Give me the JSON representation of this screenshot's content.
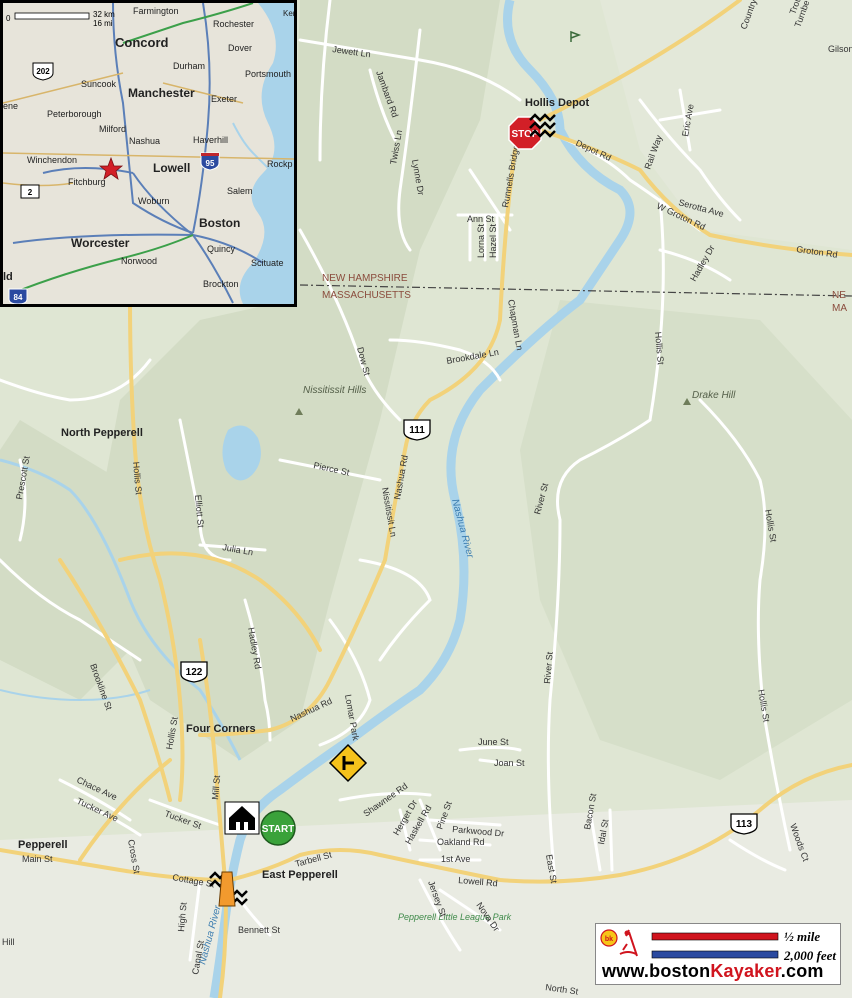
{
  "inset": {
    "scale_km": "32 km",
    "scale_mi": "16 mi",
    "scale_zero": "0",
    "cities": [
      "Farmington",
      "Rochester",
      "Dover",
      "Concord",
      "Durham",
      "Portsmouth",
      "Suncook",
      "Manchester",
      "Exeter",
      "Peterborough",
      "Milford",
      "Nashua",
      "Haverhill",
      "Winchendon",
      "Lowell",
      "Rockp",
      "Fitchburg",
      "Salem",
      "Woburn",
      "Boston",
      "Worcester",
      "Quincy",
      "Norwood",
      "Scituate",
      "Brockton",
      "Ker",
      "ene",
      "ld"
    ],
    "shields": [
      "202",
      "95",
      "2",
      "84"
    ]
  },
  "places": {
    "hollis_depot": "Hollis Depot",
    "north_pepperell": "North Pepperell",
    "four_corners": "Four Corners",
    "pepperell": "Pepperell",
    "east_pepperell": "East Pepperell",
    "nissitissit_hills": "Nissitissit Hills",
    "drake_hill": "Drake Hill",
    "nh": "NEW HAMPSHIRE",
    "ma": "MASSACHUSETTS",
    "ne": "NE",
    "ma2": "MA",
    "little_league": "Pepperell Little League Park",
    "nashua_river": "Nashua River"
  },
  "roads": [
    "Jewett Ln",
    "Jambard Rd",
    "Twiss Ln",
    "Lynne Dr",
    "Runnells Bridge Rd",
    "Ann St",
    "Lorna St",
    "Hazel St",
    "Depot Rd",
    "Rail Way",
    "Eric Ave",
    "Serotta Ave",
    "W Groton Rd",
    "Groton Rd",
    "Hadley Dr",
    "Hollis St",
    "Chapman Ln",
    "Brookdale Ln",
    "Dow St",
    "Pierce St",
    "Nashua Rd",
    "Nissitissit Ln",
    "Elliott St",
    "Julia Ln",
    "Hadley Rd",
    "River St",
    "Prescott St",
    "Brookline St",
    "Lomar Park",
    "June St",
    "Joan St",
    "Chace Ave",
    "Tucker Ave",
    "Tucker St",
    "Mill St",
    "Shawnee Rd",
    "Herget Dr",
    "Haskell Rd",
    "Pine St",
    "Parkwood Dr",
    "Oakland Rd",
    "1st Ave",
    "Tarbell St",
    "Main St",
    "Cross St",
    "Cottage St",
    "Lowell Rd",
    "Bacon St",
    "Idal St",
    "Woods Ct",
    "East St",
    "Jersey St",
    "Nova Dr",
    "Bennett St",
    "High St",
    "Canal St",
    "North St",
    "Gilson",
    "Country Side Dr",
    "Trout Brook",
    "Turnbe",
    "Hill"
  ],
  "shields": {
    "r111": "111",
    "r122": "122",
    "r113": "113"
  },
  "markers": {
    "start": "START",
    "stop": "STOP"
  },
  "legend": {
    "half_mile": "½ mile",
    "feet": "2,000 feet",
    "site_a": "www.boston",
    "site_b": "Kayaker",
    "site_c": ".com",
    "logo": "bk"
  },
  "colors": {
    "land": "#dfe6d3",
    "road": "#ffffff",
    "major": "#f2d27a",
    "water": "#a9d3ea",
    "start": "#3aa23a",
    "stop": "#d21f27",
    "half_bar": "#d0141e",
    "feet_bar": "#2b4aa0"
  }
}
